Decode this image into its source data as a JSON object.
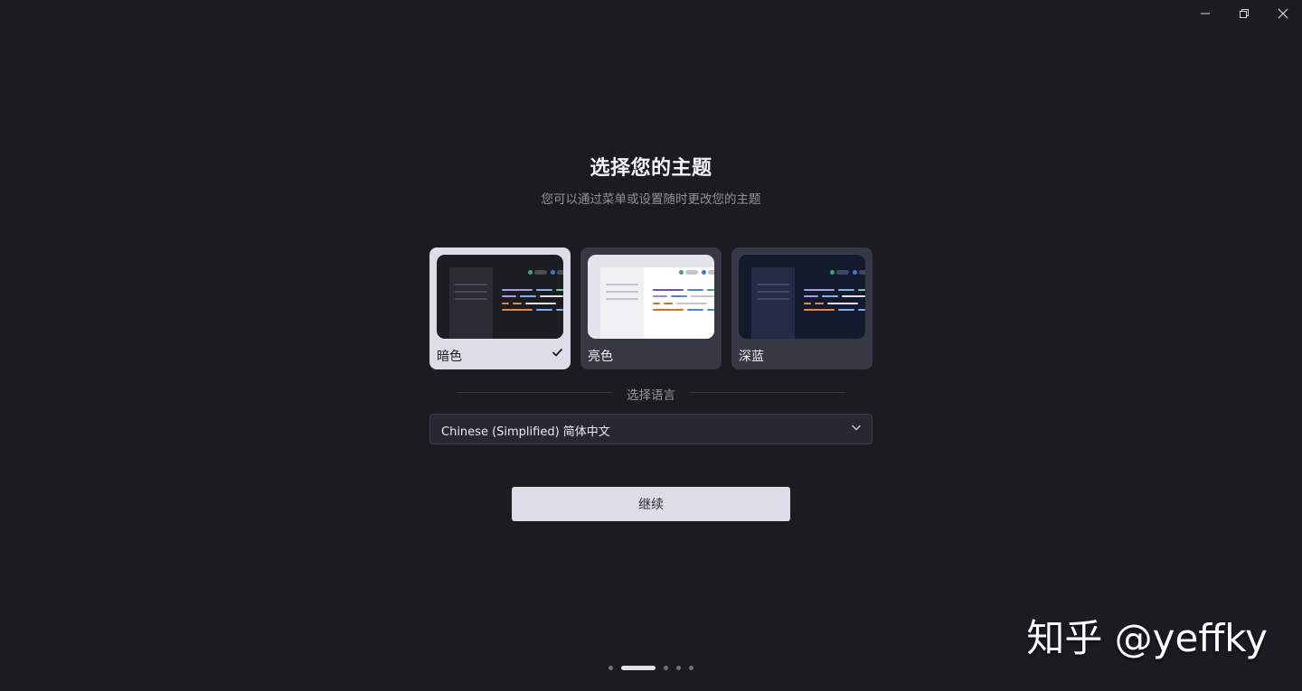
{
  "window": {
    "controls": [
      "minimize",
      "restore",
      "close"
    ]
  },
  "onboarding": {
    "title": "选择您的主题",
    "subtitle": "您可以通过菜单或设置随时更改您的主题",
    "themes": [
      {
        "label": "暗色",
        "selected": true
      },
      {
        "label": "亮色",
        "selected": false
      },
      {
        "label": "深蓝",
        "selected": false
      }
    ],
    "language_section_label": "选择语言",
    "language_select": {
      "value": "Chinese (Simplified) 简体中文"
    },
    "continue_label": "继续",
    "pager": {
      "total": 5,
      "active_index": 1
    }
  },
  "watermark": "知乎 @yeffky",
  "colors": {
    "background": "#1b1c21",
    "card": "#363844",
    "card_selected": "#dcdde6",
    "button": "#dcdde6"
  }
}
